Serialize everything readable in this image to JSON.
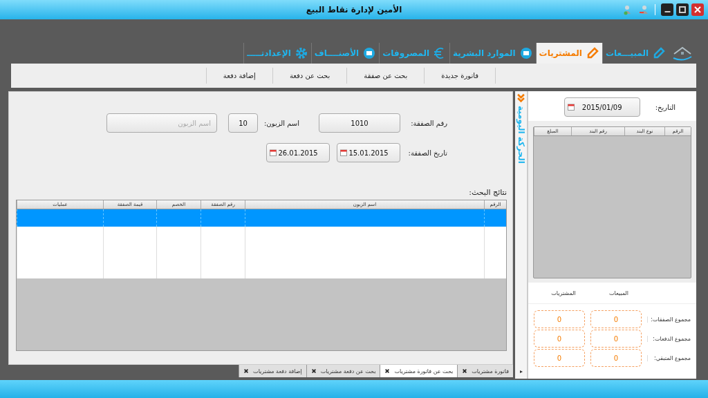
{
  "window": {
    "title": "الأمين لإدارة نقاط البيع"
  },
  "main_tabs": [
    {
      "label": "المبيـــعات",
      "selected": false
    },
    {
      "label": "المشتريات",
      "selected": true
    },
    {
      "label": "الموارد البشرية",
      "selected": false
    },
    {
      "label": "المصروفات",
      "selected": false
    },
    {
      "label": "الأصنــــاف",
      "selected": false
    },
    {
      "label": "الإعدادتـــــ",
      "selected": false
    }
  ],
  "sub_toolbar": [
    "فاتورة جديدة",
    "بحث عن صفقة",
    "بحث عن دفعة",
    "إضافة دفعة"
  ],
  "form": {
    "deal_number": {
      "label": "رقم الصفقة:",
      "value": "1010"
    },
    "customer": {
      "label": "اسم الزبون:",
      "code": "10",
      "placeholder": "اسم الزبون"
    },
    "deal_date": {
      "label": "تاريخ الصفقة:",
      "from": "15.01.2015",
      "to": "26.01.2015"
    }
  },
  "results": {
    "title": "نتائج البحث:",
    "columns": [
      "الرقم",
      "اسم الزبون",
      "رقم الصفقة",
      "الخصم",
      "قيمة الصفقة",
      "عمليات"
    ],
    "rows": [
      {
        "selected": true
      },
      {
        "selected": false
      },
      {
        "selected": false
      },
      {
        "selected": false
      }
    ]
  },
  "daily": {
    "tab_label": "الحركة اليومية",
    "date_label": "التاريخ:",
    "date": "2015/01/09",
    "columns": [
      "الرقم",
      "نوع البند",
      "رقم البند",
      "المبلغ"
    ],
    "summary_headers": [
      "المبيعات",
      "المشتريات"
    ],
    "summary_rows": [
      {
        "label": "مجموع الصفقات:",
        "sales": "0",
        "purchases": "0"
      },
      {
        "label": "مجموع الدفعات:",
        "sales": "0",
        "purchases": "0"
      },
      {
        "label": "مجموع المتبقي:",
        "sales": "0",
        "purchases": "0"
      }
    ]
  },
  "doc_tabs": [
    {
      "label": "فاتورة مشتريات",
      "selected": false
    },
    {
      "label": "بحث عن فاتورة مشتريات",
      "selected": true
    },
    {
      "label": "بحث عن دفعة مشتريات",
      "selected": false
    },
    {
      "label": "إضافة دفعة مشتريات",
      "selected": false
    }
  ]
}
